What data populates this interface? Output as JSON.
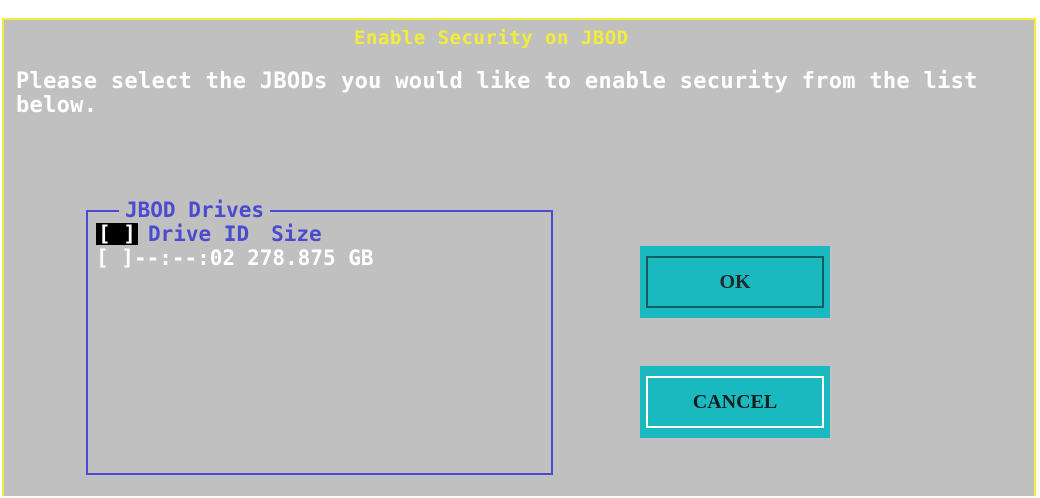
{
  "dialog": {
    "title": "Enable Security on JBOD",
    "instructions": "Please select the JBODs you would like to enable security from the list below."
  },
  "jbod_list": {
    "title": "JBOD Drives",
    "header": {
      "checkbox": "[ ]",
      "drive_id_label": "Drive ID",
      "size_label": "Size"
    },
    "drives": [
      {
        "checkbox": "[ ]",
        "drive_id": "--:--:02",
        "size": "278.875 GB"
      }
    ]
  },
  "buttons": {
    "ok_label": "OK",
    "cancel_label": "CANCEL"
  },
  "colors": {
    "background": "#c0c0c0",
    "title_yellow": "#f2ec3c",
    "group_blue": "#4b4bcf",
    "button_cyan": "#1ab9bf",
    "text_white": "#ffffff"
  }
}
